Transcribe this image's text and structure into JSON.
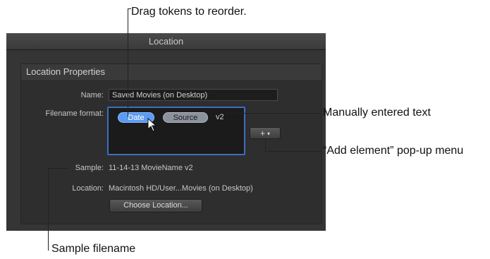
{
  "callouts": {
    "drag_tokens": "Drag tokens to reorder.",
    "manual_text": "Manually entered text",
    "add_element": "“Add element” pop-up menu",
    "sample_filename": "Sample filename"
  },
  "window": {
    "title": "Location"
  },
  "group": {
    "title": "Location Properties"
  },
  "fields": {
    "name_label": "Name:",
    "name_value": "Saved Movies (on Desktop)",
    "filename_format_label": "Filename format:",
    "tokens": [
      "Date",
      "Source"
    ],
    "typed_text": "v2",
    "add_button_plus": "+",
    "add_button_arrow": "▾",
    "sample_label": "Sample:",
    "sample_value": "11-14-13 MovieName v2",
    "location_label": "Location:",
    "location_value": "Macintosh HD/User...Movies (on Desktop)",
    "choose_location_label": "Choose Location..."
  },
  "colors": {
    "window_bg": "#353535",
    "selection_border": "#3b6fc2",
    "date_token": "#5b9cf2",
    "source_token": "#8c929c"
  },
  "icons": {
    "cursor": "arrow-pointer-icon"
  }
}
